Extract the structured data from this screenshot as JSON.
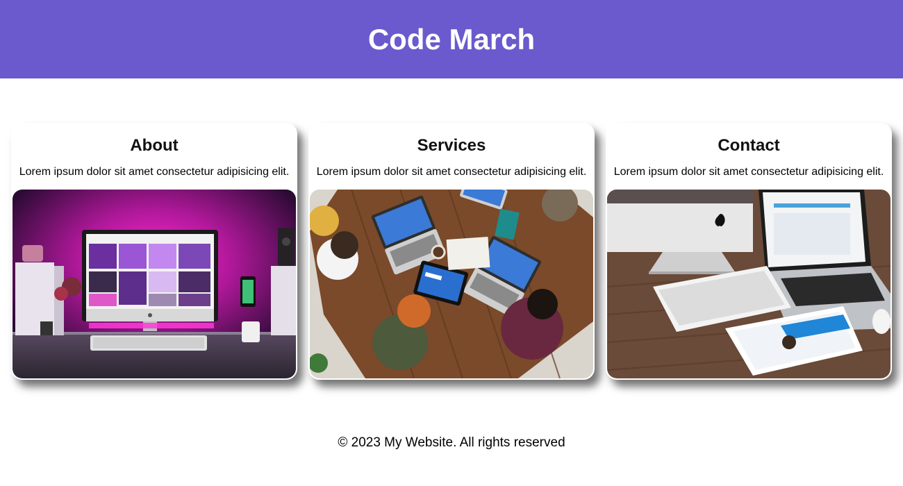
{
  "header": {
    "title": "Code March",
    "background": "#6a5acd"
  },
  "cards": [
    {
      "title": "About",
      "text": "Lorem ipsum dolor sit amet consectetur adipisicing elit.",
      "image_icon": "desk-computer-image"
    },
    {
      "title": "Services",
      "text": "Lorem ipsum dolor sit amet consectetur adipisicing elit.",
      "image_icon": "team-meeting-image"
    },
    {
      "title": "Contact",
      "text": "Lorem ipsum dolor sit amet consectetur adipisicing elit.",
      "image_icon": "apple-devices-image"
    }
  ],
  "footer": {
    "text": "© 2023 My Website. All rights reserved"
  }
}
